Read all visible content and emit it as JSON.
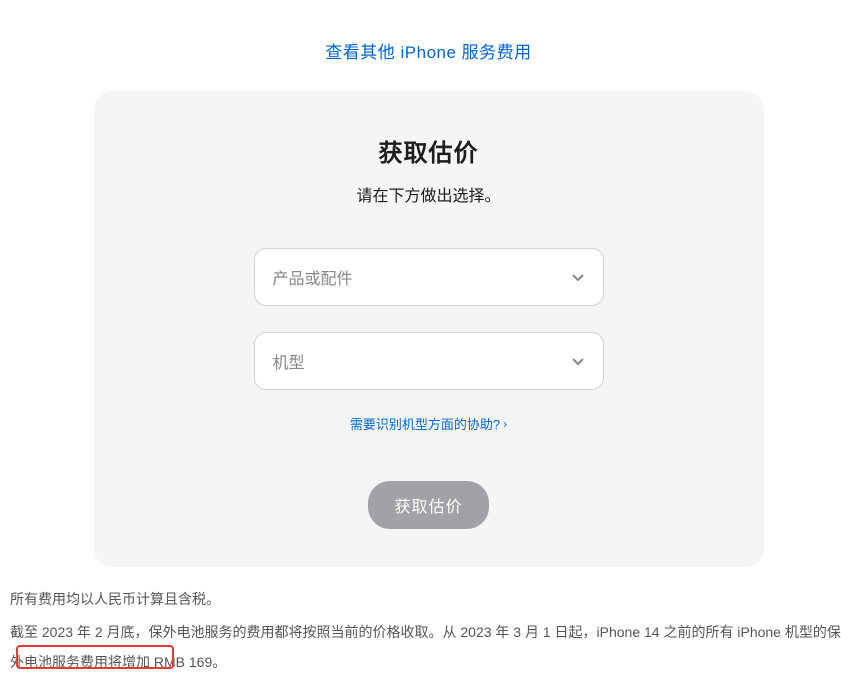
{
  "topLink": {
    "label": "查看其他 iPhone 服务费用"
  },
  "card": {
    "title": "获取估价",
    "subtitle": "请在下方做出选择。",
    "select1": {
      "placeholder": "产品或配件"
    },
    "select2": {
      "placeholder": "机型"
    },
    "helpLink": {
      "label": "需要识别机型方面的协助?"
    },
    "submitButton": {
      "label": "获取估价"
    }
  },
  "footer": {
    "line1": "所有费用均以人民币计算且含税。",
    "line2": "截至 2023 年 2 月底，保外电池服务的费用都将按照当前的价格收取。从 2023 年 3 月 1 日起，iPhone 14 之前的所有 iPhone 机型的保外电池服务费用将增加 RMB 169。"
  }
}
